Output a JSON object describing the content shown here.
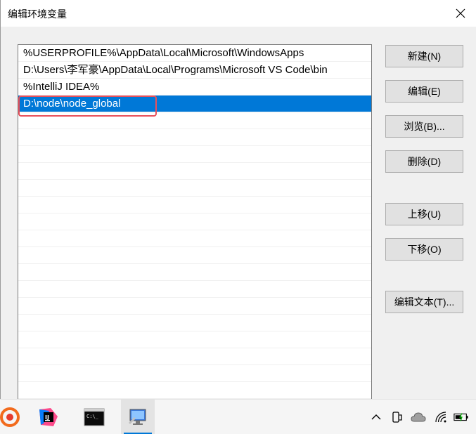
{
  "window": {
    "title": "编辑环境变量"
  },
  "paths": [
    "%USERPROFILE%\\AppData\\Local\\Microsoft\\WindowsApps",
    "D:\\Users\\李军豪\\AppData\\Local\\Programs\\Microsoft VS Code\\bin",
    "%IntelliJ IDEA%",
    "D:\\node\\node_global"
  ],
  "selected_index": 3,
  "buttons": {
    "new": "新建(N)",
    "edit": "编辑(E)",
    "browse": "浏览(B)...",
    "delete": "删除(D)",
    "move_up": "上移(U)",
    "move_down": "下移(O)",
    "edit_text": "编辑文本(T)..."
  },
  "colors": {
    "selection": "#0078d7",
    "highlight_border": "#e8505b"
  },
  "taskbar": {
    "apps": [
      "sogou-input-icon",
      "intellij-idea-icon",
      "command-prompt-icon",
      "system-properties-icon"
    ],
    "tray": [
      "chevron-up-icon",
      "phone-link-icon",
      "onedrive-cloud-icon",
      "wifi-icon",
      "battery-icon"
    ]
  }
}
